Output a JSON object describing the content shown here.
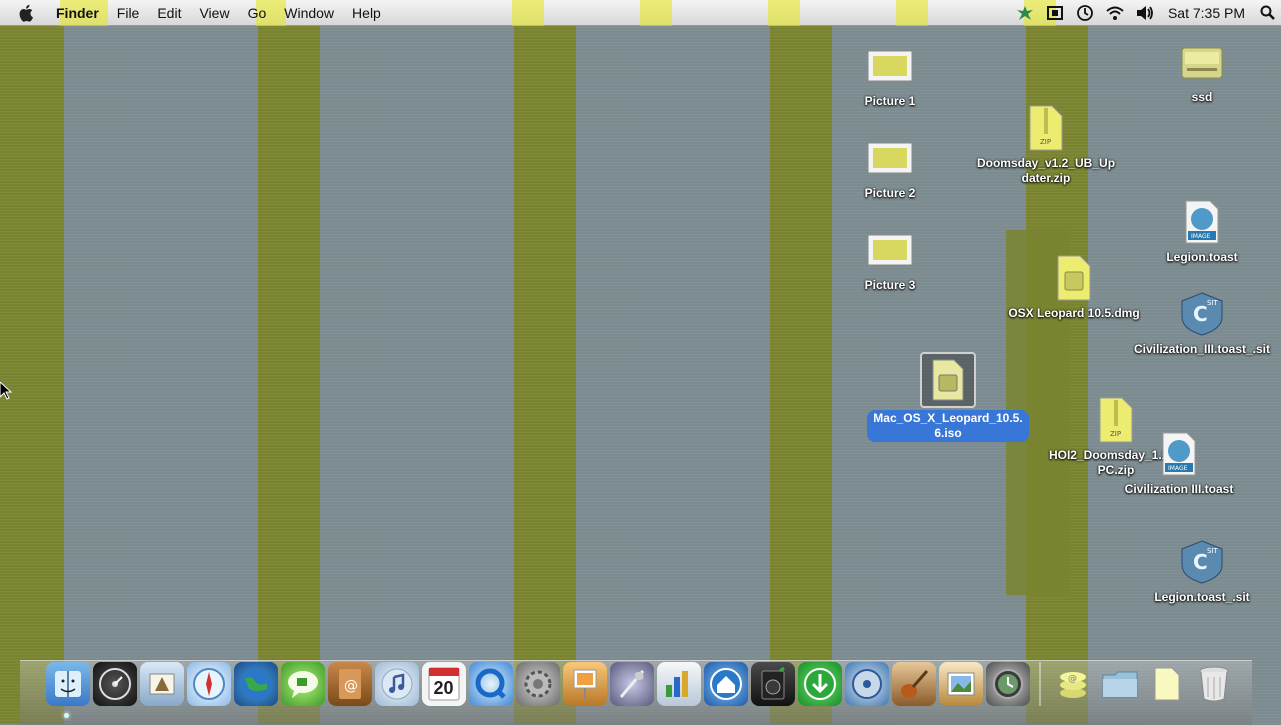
{
  "menubar": {
    "app_name": "Finder",
    "menus": [
      "File",
      "Edit",
      "View",
      "Go",
      "Window",
      "Help"
    ],
    "clock": "Sat 7:35 PM"
  },
  "desktop_icons": [
    {
      "label": "Picture 1",
      "icon": "screenshot-picture-icon"
    },
    {
      "label": "Picture 2",
      "icon": "screenshot-picture-icon"
    },
    {
      "label": "Picture 3",
      "icon": "screenshot-picture-icon"
    },
    {
      "label": "ssd",
      "icon": "hard-drive-icon"
    },
    {
      "label": "Doomsday_v1.2_UB_Updater.zip",
      "icon": "zip-file-icon"
    },
    {
      "label": "Legion.toast",
      "icon": "toast-image-icon"
    },
    {
      "label": "OSX Leopard 10.5.dmg",
      "icon": "dmg-disk-image-icon"
    },
    {
      "label": "Civilization_III.toast_.sit",
      "icon": "stuffit-archive-icon"
    },
    {
      "label": "Mac_OS_X_Leopard_10.5.6.iso",
      "icon": "iso-disk-image-icon",
      "selected": true
    },
    {
      "label": "HOI2_Doomsday_1.2_PPC.zip",
      "icon": "zip-file-icon"
    },
    {
      "label": "Civilization III.toast",
      "icon": "toast-image-icon"
    },
    {
      "label": "Legion.toast_.sit",
      "icon": "stuffit-archive-icon"
    }
  ],
  "dock": {
    "calendar_day": "20",
    "items": [
      "Finder",
      "Dashboard",
      "Mail",
      "Safari",
      "Network",
      "iChat",
      "Address Book",
      "iTunes",
      "iCal",
      "QuickTime",
      "System Preferences",
      "Preview",
      "Script Editor",
      "Numbers",
      "Home",
      "Audio App",
      "Downloader",
      "DVD Player",
      "GarageBand",
      "iPhoto",
      "Time Machine",
      "Stack",
      "Documents",
      "File",
      "Trash"
    ]
  },
  "colors": {
    "selection": "#3876d8",
    "wallpaper_grey": "#7b8b8f",
    "wallpaper_olive": "#7a8430"
  }
}
